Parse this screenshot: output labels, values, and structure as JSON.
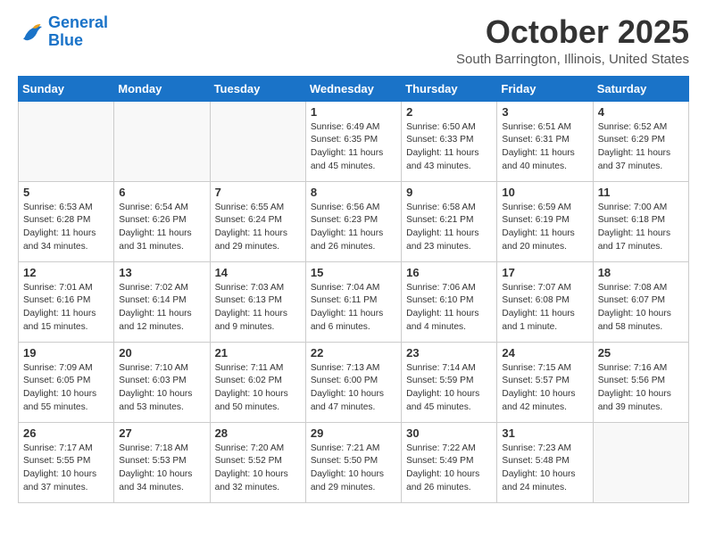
{
  "header": {
    "logo_line1": "General",
    "logo_line2": "Blue",
    "month": "October 2025",
    "location": "South Barrington, Illinois, United States"
  },
  "weekdays": [
    "Sunday",
    "Monday",
    "Tuesday",
    "Wednesday",
    "Thursday",
    "Friday",
    "Saturday"
  ],
  "weeks": [
    [
      {
        "num": "",
        "info": ""
      },
      {
        "num": "",
        "info": ""
      },
      {
        "num": "",
        "info": ""
      },
      {
        "num": "1",
        "info": "Sunrise: 6:49 AM\nSunset: 6:35 PM\nDaylight: 11 hours\nand 45 minutes."
      },
      {
        "num": "2",
        "info": "Sunrise: 6:50 AM\nSunset: 6:33 PM\nDaylight: 11 hours\nand 43 minutes."
      },
      {
        "num": "3",
        "info": "Sunrise: 6:51 AM\nSunset: 6:31 PM\nDaylight: 11 hours\nand 40 minutes."
      },
      {
        "num": "4",
        "info": "Sunrise: 6:52 AM\nSunset: 6:29 PM\nDaylight: 11 hours\nand 37 minutes."
      }
    ],
    [
      {
        "num": "5",
        "info": "Sunrise: 6:53 AM\nSunset: 6:28 PM\nDaylight: 11 hours\nand 34 minutes."
      },
      {
        "num": "6",
        "info": "Sunrise: 6:54 AM\nSunset: 6:26 PM\nDaylight: 11 hours\nand 31 minutes."
      },
      {
        "num": "7",
        "info": "Sunrise: 6:55 AM\nSunset: 6:24 PM\nDaylight: 11 hours\nand 29 minutes."
      },
      {
        "num": "8",
        "info": "Sunrise: 6:56 AM\nSunset: 6:23 PM\nDaylight: 11 hours\nand 26 minutes."
      },
      {
        "num": "9",
        "info": "Sunrise: 6:58 AM\nSunset: 6:21 PM\nDaylight: 11 hours\nand 23 minutes."
      },
      {
        "num": "10",
        "info": "Sunrise: 6:59 AM\nSunset: 6:19 PM\nDaylight: 11 hours\nand 20 minutes."
      },
      {
        "num": "11",
        "info": "Sunrise: 7:00 AM\nSunset: 6:18 PM\nDaylight: 11 hours\nand 17 minutes."
      }
    ],
    [
      {
        "num": "12",
        "info": "Sunrise: 7:01 AM\nSunset: 6:16 PM\nDaylight: 11 hours\nand 15 minutes."
      },
      {
        "num": "13",
        "info": "Sunrise: 7:02 AM\nSunset: 6:14 PM\nDaylight: 11 hours\nand 12 minutes."
      },
      {
        "num": "14",
        "info": "Sunrise: 7:03 AM\nSunset: 6:13 PM\nDaylight: 11 hours\nand 9 minutes."
      },
      {
        "num": "15",
        "info": "Sunrise: 7:04 AM\nSunset: 6:11 PM\nDaylight: 11 hours\nand 6 minutes."
      },
      {
        "num": "16",
        "info": "Sunrise: 7:06 AM\nSunset: 6:10 PM\nDaylight: 11 hours\nand 4 minutes."
      },
      {
        "num": "17",
        "info": "Sunrise: 7:07 AM\nSunset: 6:08 PM\nDaylight: 11 hours\nand 1 minute."
      },
      {
        "num": "18",
        "info": "Sunrise: 7:08 AM\nSunset: 6:07 PM\nDaylight: 10 hours\nand 58 minutes."
      }
    ],
    [
      {
        "num": "19",
        "info": "Sunrise: 7:09 AM\nSunset: 6:05 PM\nDaylight: 10 hours\nand 55 minutes."
      },
      {
        "num": "20",
        "info": "Sunrise: 7:10 AM\nSunset: 6:03 PM\nDaylight: 10 hours\nand 53 minutes."
      },
      {
        "num": "21",
        "info": "Sunrise: 7:11 AM\nSunset: 6:02 PM\nDaylight: 10 hours\nand 50 minutes."
      },
      {
        "num": "22",
        "info": "Sunrise: 7:13 AM\nSunset: 6:00 PM\nDaylight: 10 hours\nand 47 minutes."
      },
      {
        "num": "23",
        "info": "Sunrise: 7:14 AM\nSunset: 5:59 PM\nDaylight: 10 hours\nand 45 minutes."
      },
      {
        "num": "24",
        "info": "Sunrise: 7:15 AM\nSunset: 5:57 PM\nDaylight: 10 hours\nand 42 minutes."
      },
      {
        "num": "25",
        "info": "Sunrise: 7:16 AM\nSunset: 5:56 PM\nDaylight: 10 hours\nand 39 minutes."
      }
    ],
    [
      {
        "num": "26",
        "info": "Sunrise: 7:17 AM\nSunset: 5:55 PM\nDaylight: 10 hours\nand 37 minutes."
      },
      {
        "num": "27",
        "info": "Sunrise: 7:18 AM\nSunset: 5:53 PM\nDaylight: 10 hours\nand 34 minutes."
      },
      {
        "num": "28",
        "info": "Sunrise: 7:20 AM\nSunset: 5:52 PM\nDaylight: 10 hours\nand 32 minutes."
      },
      {
        "num": "29",
        "info": "Sunrise: 7:21 AM\nSunset: 5:50 PM\nDaylight: 10 hours\nand 29 minutes."
      },
      {
        "num": "30",
        "info": "Sunrise: 7:22 AM\nSunset: 5:49 PM\nDaylight: 10 hours\nand 26 minutes."
      },
      {
        "num": "31",
        "info": "Sunrise: 7:23 AM\nSunset: 5:48 PM\nDaylight: 10 hours\nand 24 minutes."
      },
      {
        "num": "",
        "info": ""
      }
    ]
  ]
}
